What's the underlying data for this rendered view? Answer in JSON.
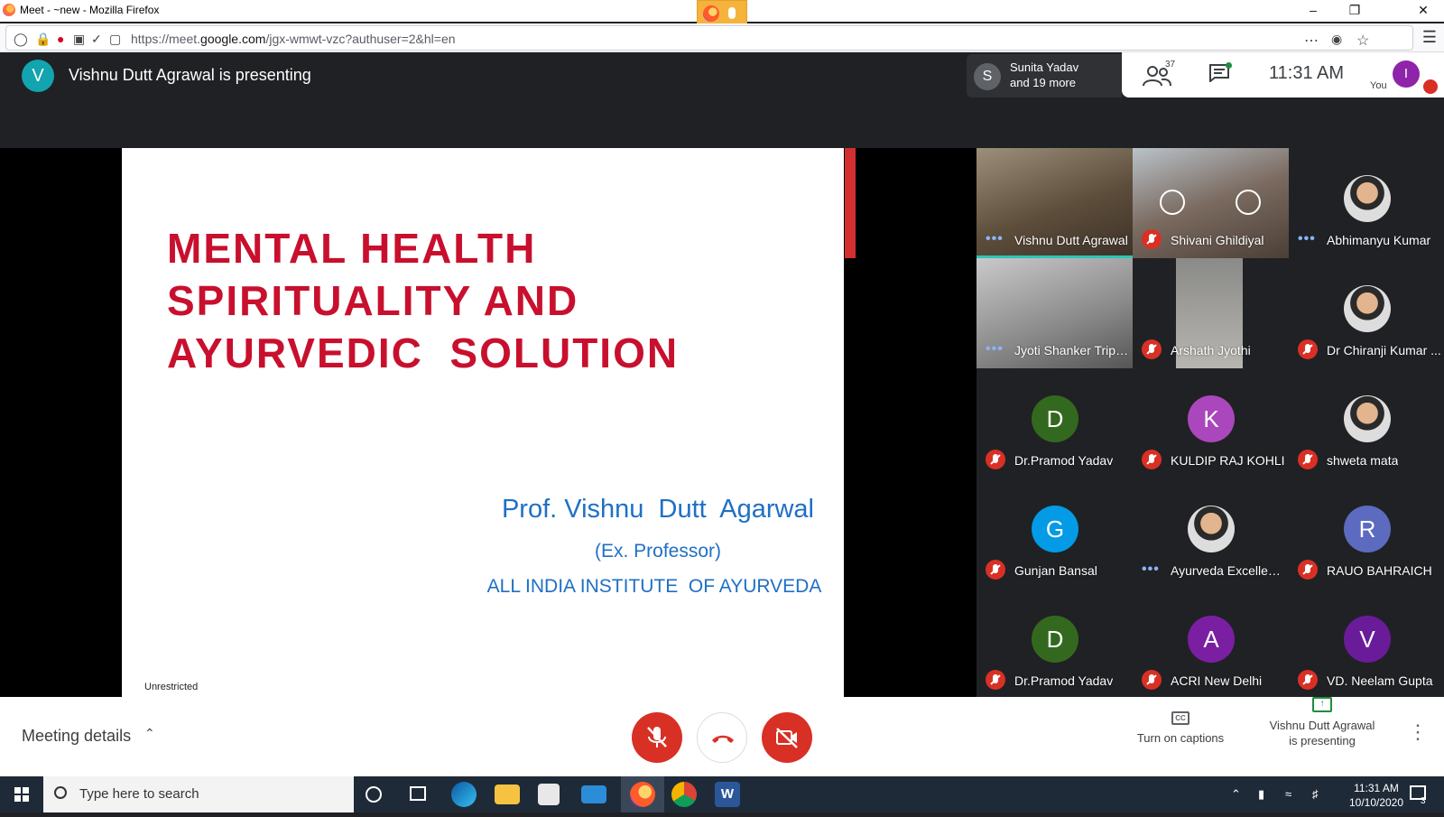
{
  "browser": {
    "window_title": "Meet - ~new - Mozilla Firefox",
    "url_prefix": "https://meet.",
    "url_domain": "google.com",
    "url_path": "/jgx-wmwt-vzc?authuser=2&hl=en"
  },
  "header": {
    "presenter_initial": "V",
    "presenting_text": "Vishnu Dutt Agrawal is presenting",
    "participants_initial": "S",
    "participants_line1": "Sunita Yadav",
    "participants_line2": "and 19 more",
    "people_count": "37",
    "time": "11:31  AM",
    "you_initial": "I",
    "you_label": "You"
  },
  "slide": {
    "title_line1": "MENTAL HEALTH",
    "title_line2": "SPIRITUALITY AND",
    "title_line3": "AYURVEDIC  SOLUTION",
    "author": "Prof. Vishnu  Dutt  Agarwal",
    "role": "(Ex. Professor)",
    "institute": "ALL INDIA INSTITUTE  OF AYURVEDA",
    "footer": "Unrestricted"
  },
  "participants": [
    {
      "name": "Vishnu Dutt Agrawal",
      "initial": "",
      "type": "video",
      "muted": false
    },
    {
      "name": "Shivani Ghildiyal",
      "initial": "",
      "type": "video",
      "muted": true
    },
    {
      "name": "Abhimanyu Kumar",
      "initial": "",
      "type": "photo",
      "muted": false
    },
    {
      "name": "Jyoti Shanker Tripa...",
      "initial": "",
      "type": "video",
      "muted": false
    },
    {
      "name": "Arshath Jyothi",
      "initial": "",
      "type": "video",
      "muted": true
    },
    {
      "name": "Dr Chiranji Kumar ...",
      "initial": "",
      "type": "photo",
      "muted": true
    },
    {
      "name": "Dr.Pramod Yadav",
      "initial": "D",
      "type": "letter",
      "color": "#33691e",
      "muted": true
    },
    {
      "name": "KULDIP RAJ KOHLI",
      "initial": "K",
      "type": "letter",
      "color": "#ab47bc",
      "muted": true
    },
    {
      "name": "shweta mata",
      "initial": "",
      "type": "photo",
      "muted": true
    },
    {
      "name": "Gunjan Bansal",
      "initial": "G",
      "type": "letter",
      "color": "#039be5",
      "muted": true
    },
    {
      "name": "Ayurveda Excellence",
      "initial": "",
      "type": "photo",
      "muted": false
    },
    {
      "name": "RAUO BAHRAICH",
      "initial": "R",
      "type": "letter",
      "color": "#5c6bc0",
      "muted": true
    },
    {
      "name": "Dr.Pramod Yadav",
      "initial": "D",
      "type": "letter",
      "color": "#33691e",
      "muted": true
    },
    {
      "name": "ACRI New Delhi",
      "initial": "A",
      "type": "letter",
      "color": "#7b1fa2",
      "muted": true
    },
    {
      "name": "VD. Neelam Gupta",
      "initial": "V",
      "type": "letter",
      "color": "#6a1b9a",
      "muted": true
    }
  ],
  "bottom": {
    "meeting_details": "Meeting details",
    "captions_label": "Turn on captions",
    "present_line1": "Vishnu Dutt Agrawal",
    "present_line2": "is presenting"
  },
  "taskbar": {
    "search_placeholder": "Type here to search",
    "time": "11:31 AM",
    "date": "10/10/2020",
    "notifications": "3"
  }
}
